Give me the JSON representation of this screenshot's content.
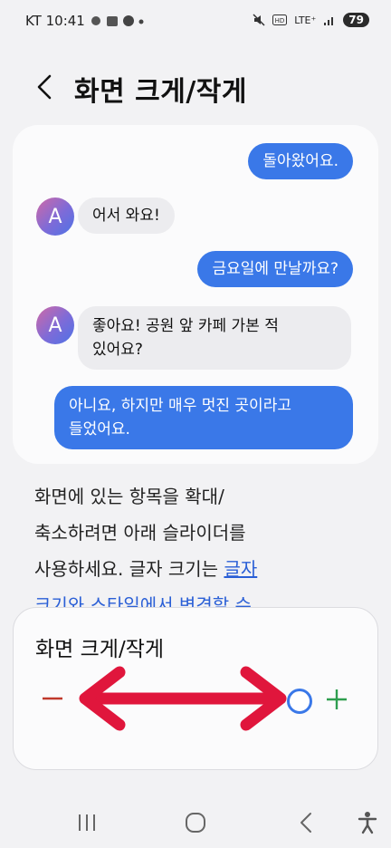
{
  "status": {
    "carrier_time": "KT 10:41",
    "network": "LTE⁺",
    "battery": "79"
  },
  "header": {
    "title": "화면 크게/작게"
  },
  "chat": {
    "messages": [
      {
        "type": "sent",
        "text": "돌아왔어요."
      },
      {
        "type": "received",
        "avatar": "A",
        "text": "어서 와요!"
      },
      {
        "type": "sent",
        "text": "금요일에 만날까요?"
      },
      {
        "type": "received",
        "avatar": "A",
        "line1": "좋아요! 공원 앞 카페 가본 적",
        "line2": "있어요?"
      },
      {
        "type": "sent",
        "line1": "아니요, 하지만 매우 멋진 곳이라고",
        "line2": "들었어요."
      }
    ]
  },
  "description": {
    "line1": "화면에 있는 항목을 확대/",
    "line2": "축소하려면 아래 슬라이더를",
    "line3_prefix": "사용하세요. 글자 크기는 ",
    "link": "글자",
    "line4_partial": "크기와 스타일에서 변경할 수"
  },
  "zoom_panel": {
    "title": "화면 크게/작게",
    "level_fraction": 1.0
  },
  "colors": {
    "accent": "#3a78e8",
    "minus": "#c0392b",
    "plus": "#2e9e4f",
    "annotation_arrow": "#e0163c"
  },
  "nav": {
    "recents_icon": "recents-icon",
    "home_icon": "home-icon",
    "back_icon": "back-icon",
    "accessibility_icon": "accessibility-icon"
  }
}
